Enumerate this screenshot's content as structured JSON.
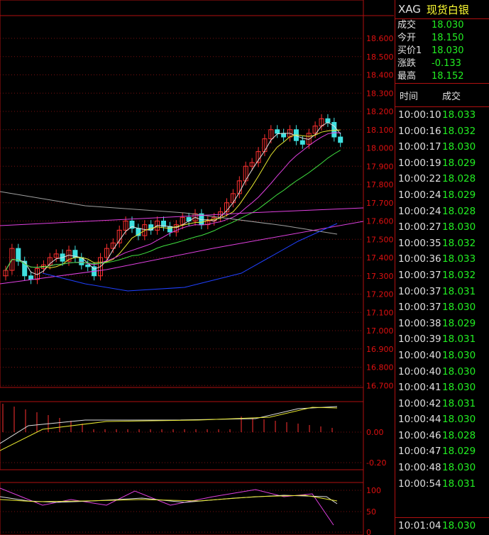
{
  "panel": {
    "symbol": "XAG",
    "name": "现货白银",
    "quote": [
      {
        "k": "成交",
        "v": "18.030"
      },
      {
        "k": "今开",
        "v": "18.150"
      },
      {
        "k": "买价1",
        "v": "18.030"
      },
      {
        "k": "涨跌",
        "v": "-0.133"
      },
      {
        "k": "最高",
        "v": "18.152"
      }
    ],
    "ticks_header": {
      "time": "时间",
      "price": "成交"
    },
    "ticks": [
      {
        "t": "10:00:10",
        "p": "18.033"
      },
      {
        "t": "10:00:16",
        "p": "18.032"
      },
      {
        "t": "10:00:17",
        "p": "18.030"
      },
      {
        "t": "10:00:19",
        "p": "18.029"
      },
      {
        "t": "10:00:22",
        "p": "18.028"
      },
      {
        "t": "10:00:24",
        "p": "18.029"
      },
      {
        "t": "10:00:24",
        "p": "18.028"
      },
      {
        "t": "10:00:27",
        "p": "18.030"
      },
      {
        "t": "10:00:35",
        "p": "18.032"
      },
      {
        "t": "10:00:36",
        "p": "18.033"
      },
      {
        "t": "10:00:37",
        "p": "18.032"
      },
      {
        "t": "10:00:37",
        "p": "18.031"
      },
      {
        "t": "10:00:37",
        "p": "18.030"
      },
      {
        "t": "10:00:38",
        "p": "18.029"
      },
      {
        "t": "10:00:39",
        "p": "18.031"
      },
      {
        "t": "10:00:40",
        "p": "18.030"
      },
      {
        "t": "10:00:40",
        "p": "18.030"
      },
      {
        "t": "10:00:41",
        "p": "18.030"
      },
      {
        "t": "10:00:42",
        "p": "18.031"
      },
      {
        "t": "10:00:44",
        "p": "18.030"
      },
      {
        "t": "10:00:46",
        "p": "18.028"
      },
      {
        "t": "10:00:47",
        "p": "18.029"
      },
      {
        "t": "10:00:48",
        "p": "18.030"
      },
      {
        "t": "10:00:54",
        "p": "18.031"
      }
    ],
    "last": {
      "t": "10:01:04",
      "p": "18.030"
    }
  },
  "axes": {
    "price_ticks": [
      "18.600",
      "18.500",
      "18.400",
      "18.300",
      "18.200",
      "18.100",
      "18.000",
      "17.900",
      "17.800",
      "17.700",
      "17.600",
      "17.500",
      "17.400",
      "17.300",
      "17.200",
      "17.100",
      "17.000",
      "16.900",
      "16.800",
      "16.700"
    ],
    "macd_ticks": [
      "0.00",
      "-0.20"
    ],
    "kdj_ticks": [
      "100",
      "50",
      "0"
    ]
  },
  "colors": {
    "up": "#ff3030",
    "down": "#40e0e0",
    "grid": "#7a1010",
    "ma_white": "#e0e0e0",
    "ma_yellow": "#e8e830",
    "ma_magenta": "#e040e0",
    "ma_green": "#40e040",
    "ma_gray": "#a0a0a0",
    "ma_blue": "#2040ff"
  }
}
